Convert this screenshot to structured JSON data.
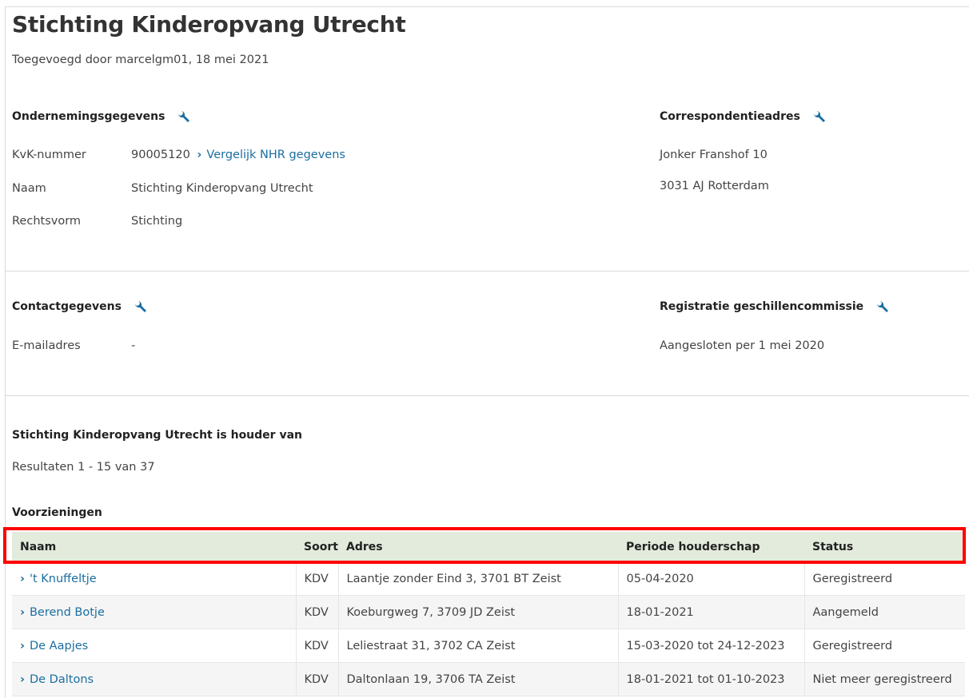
{
  "header": {
    "title": "Stichting Kinderopvang Utrecht",
    "added_by": "Toegevoegd door marcelgm01, 18 mei 2021"
  },
  "company": {
    "heading": "Ondernemingsgegevens",
    "kvk_label": "KvK-nummer",
    "kvk_value": "90005120",
    "compare_link": "Vergelijk NHR gegevens",
    "name_label": "Naam",
    "name_value": "Stichting Kinderopvang Utrecht",
    "legal_label": "Rechtsvorm",
    "legal_value": "Stichting"
  },
  "correspondence": {
    "heading": "Correspondentieadres",
    "line1": "Jonker Franshof 10",
    "line2": "3031 AJ Rotterdam"
  },
  "contact": {
    "heading": "Contactgegevens",
    "email_label": "E-mailadres",
    "email_value": "-"
  },
  "dispute": {
    "heading": "Registratie geschillencommissie",
    "value": "Aangesloten per 1 mei 2020"
  },
  "holder": {
    "heading": "Stichting Kinderopvang Utrecht is houder van",
    "results": "Resultaten 1 - 15 van 37",
    "facilities_heading": "Voorzieningen"
  },
  "table": {
    "columns": [
      "Naam",
      "Soort",
      "Adres",
      "Periode houderschap",
      "Status"
    ],
    "rows": [
      {
        "name": "'t Knuffeltje",
        "type": "KDV",
        "address": "Laantje zonder Eind 3, 3701 BT Zeist",
        "period": "05-04-2020",
        "status": "Geregistreerd"
      },
      {
        "name": "Berend Botje",
        "type": "KDV",
        "address": "Koeburgweg 7, 3709 JD Zeist",
        "period": "18-01-2021",
        "status": "Aangemeld"
      },
      {
        "name": "De Aapjes",
        "type": "KDV",
        "address": "Leliestraat 31, 3702 CA Zeist",
        "period": "15-03-2020 tot 24-12-2023",
        "status": "Geregistreerd"
      },
      {
        "name": "De Daltons",
        "type": "KDV",
        "address": "Daltonlaan 19, 3706 TA Zeist",
        "period": "18-01-2021 tot 01-10-2023",
        "status": "Niet meer geregistreerd"
      }
    ]
  },
  "colors": {
    "link": "#1a6ea0",
    "table_header_bg": "#e3ebdc",
    "highlight": "#ff0000"
  },
  "icons": {
    "edit": "wrench-icon",
    "row_link": "chevron-right-icon"
  }
}
